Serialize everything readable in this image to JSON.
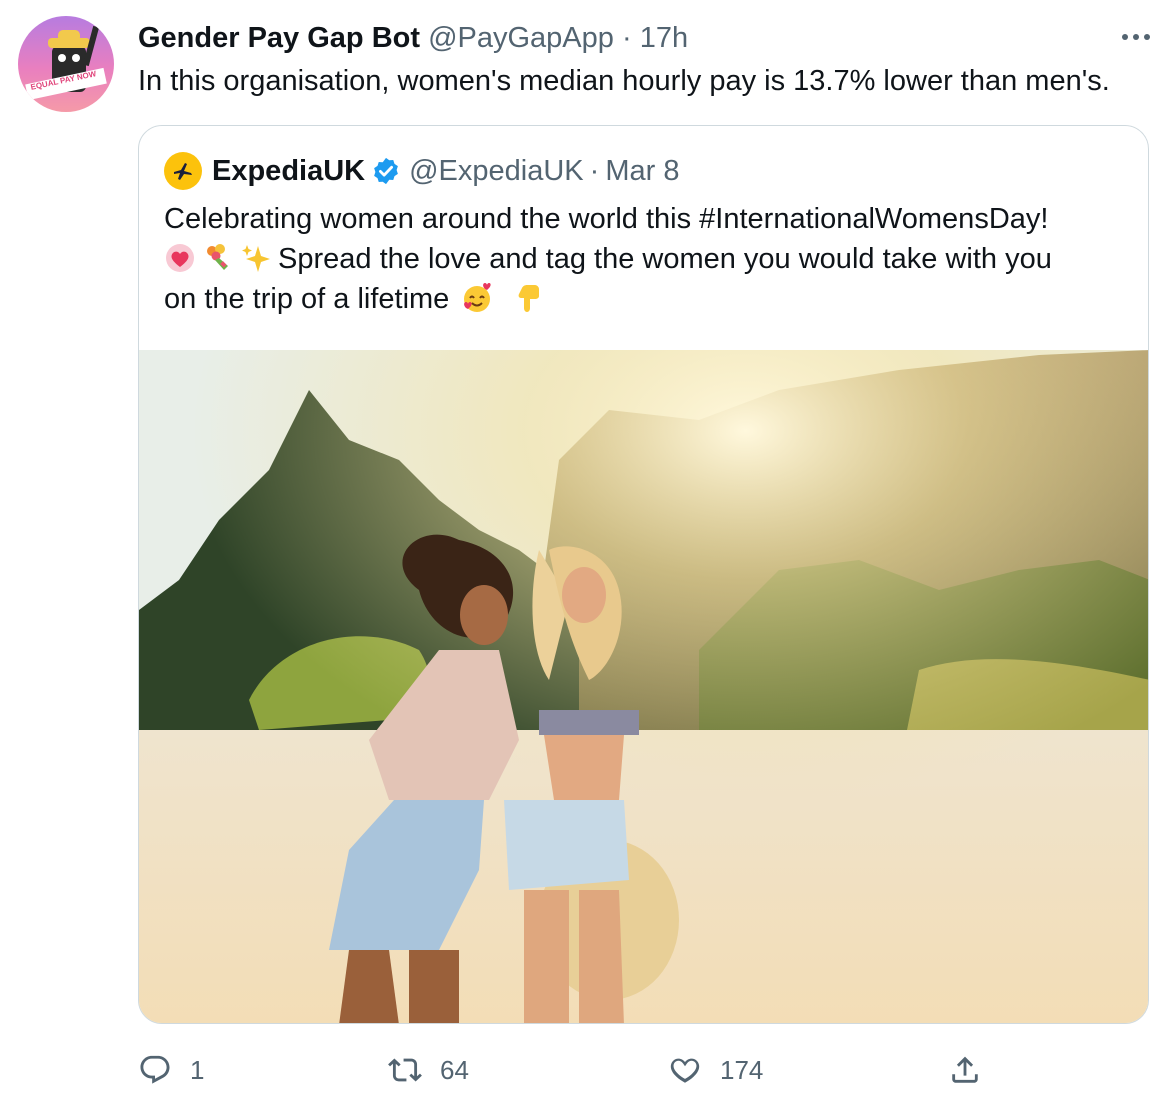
{
  "tweet": {
    "author_name": "Gender Pay Gap Bot",
    "handle": "@PayGapApp",
    "separator": "·",
    "time": "17h",
    "text": "In this organisation, women's median hourly pay is 13.7% lower than men's.",
    "avatar_caption": "EQUAL PAY NOW"
  },
  "quoted": {
    "author_name": "ExpediaUK",
    "handle": "@ExpediaUK",
    "separator": "·",
    "date": "Mar 8",
    "line1": "Celebrating women around the world this #InternationalWomensDay!",
    "line2": "Spread the love and tag the women you would take with you",
    "line3": "on the trip of a lifetime",
    "emojis": [
      "heart-icon",
      "bouquet-icon",
      "sparkles-icon",
      "smiling-face-with-hearts-icon",
      "pointing-down-icon"
    ],
    "image_description_icon": "beach-photo"
  },
  "actions": {
    "reply_count": "1",
    "retweet_count": "64",
    "like_count": "174"
  },
  "colors": {
    "text": "#0f1419",
    "muted": "#536471",
    "border": "#cfd9de",
    "verified": "#1d9bf0",
    "expedia_yellow": "#fcc20c"
  }
}
